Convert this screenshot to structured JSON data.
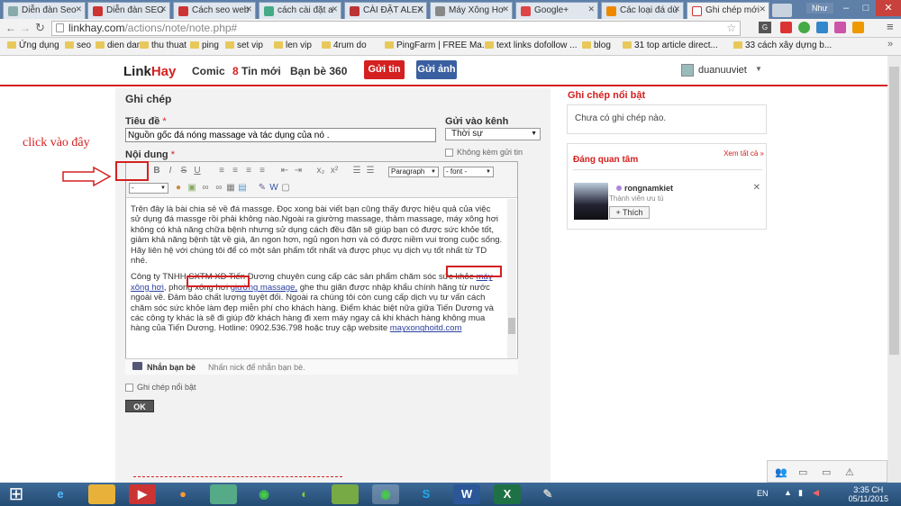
{
  "browser": {
    "tabs": [
      {
        "label": "Diễn đàn Seo",
        "icon": "doc-icon",
        "color": "#8aa"
      },
      {
        "label": "Diễn đàn SEO",
        "icon": "idvs-icon",
        "color": "#c33"
      },
      {
        "label": "Cách seo web",
        "icon": "idvs-icon",
        "color": "#c33"
      },
      {
        "label": "cách cài đặt a",
        "icon": "google-icon",
        "color": "#4a8"
      },
      {
        "label": "CÀI ĐẶT ALEX",
        "icon": "site-icon",
        "color": "#b33"
      },
      {
        "label": "Máy Xông Hơ",
        "icon": "puzzle-icon",
        "color": "#888"
      },
      {
        "label": "Google+",
        "icon": "gplus-icon",
        "color": "#d44"
      },
      {
        "label": "Các loại đá dù",
        "icon": "blogger-icon",
        "color": "#e80"
      },
      {
        "label": "Ghi chép mới",
        "icon": "linkhay-icon",
        "color": "#fff"
      }
    ],
    "user_label": "Như",
    "url_host": "linkhay.com",
    "url_path": "/actions/note/note.php#",
    "bookmarks": [
      "Ứng dụng",
      "seo",
      "dien dan",
      "thu thuat",
      "ping",
      "set vip",
      "len vip",
      "4rum do",
      "PingFarm | FREE Ma...",
      "text links dofollow ...",
      "blog",
      "31 top article direct...",
      "33 cách xây dựng b..."
    ]
  },
  "site": {
    "logo_a": "Link",
    "logo_b": "Hay",
    "nav_comic": "Comic",
    "nav_news_count": "8",
    "nav_news": "Tin mới",
    "nav_friends": "Bạn bè 360",
    "post_link_button": "Gửi tin",
    "post_image_button": "Gửi ảnh",
    "username": "duanuuviet"
  },
  "form": {
    "page_title": "Ghi chép",
    "title_label": "Tiêu đề",
    "title_value": "Nguồn gốc đá nóng massage và tác dụng của nó .",
    "channel_label": "Gửi vào kênh",
    "channel_value": "Thời sự",
    "no_send_label": "Không kèm gửi tin",
    "content_label": "Nội dung",
    "paragraph_select": "Paragraph",
    "font_select": "- font -",
    "size_select": "-",
    "body_p1": "Trên đây là bài chia sẻ về đá massge. Đọc xong bài viết bạn cũng thấy được hiệu quả của việc sử dụng đá massge rồi phải không nào.Ngoài ra giường massage, thảm massage, máy xông hơi không có khả năng chữa bệnh nhưng sử dụng cách đều đặn sẽ giúp bạn có được sức khỏe tốt, giảm khả năng bệnh tật về già, ăn ngon hơn, ngủ ngon hơn và có được niềm vui trong cuộc sống. Hãy liên hệ với chúng tôi để có một sản phẩm tốt nhất và được phục vụ dịch vụ tốt nhất từ TD nhé.",
    "body_p2_a": "Công ty TNHH SXTM XD Tiến Dương chuyên cung cấp các sản phẩm chăm sóc sức khỏe ",
    "body_link1": "máy xông hơi",
    "body_p2_b": ", phong xông hơi ",
    "body_link2": "giường massage,",
    "body_p2_c": " ghe thu giãn được nhập khẩu chính hãng từ nước ngoài về. Đảm bảo chất lượng tuyệt đối. Ngoài ra chúng  tôi còn cung cấp dịch vụ tư vấn cách chăm sóc sức khỏe làm đẹp miễn phí cho khách hàng. Điểm khác biệt nữa giữa Tiến Dương và các công ty khác là sẽ đi giúp đỡ khách hàng đi xem máy ngay cả khi khách hàng không mua hàng của Tiến Dương. Hotline: 0902.536.798 hoặc truy cập website ",
    "body_link3": "mayxonghoitd.com",
    "friends_label": "Nhắn bạn bè",
    "friends_placeholder": "Nhấn nick để nhắn bạn bè.",
    "featured_label": "Ghi chép nổi bật",
    "ok_button": "OK"
  },
  "annotation": {
    "text": "click vào đây",
    "color": "#d42020"
  },
  "right_panel": {
    "featured_title": "Ghi chép nổi bật",
    "featured_empty": "Chưa có ghi chép nào.",
    "interest_title": "Đáng quan tâm",
    "see_all": "Xem tất cả »",
    "user_name": "rongnamkiet",
    "user_role": "Thành viên ưu tú",
    "follow_button": "+ Thích"
  },
  "taskbar": {
    "lang": "EN",
    "time": "3:35 CH",
    "date": "05/11/2015"
  }
}
